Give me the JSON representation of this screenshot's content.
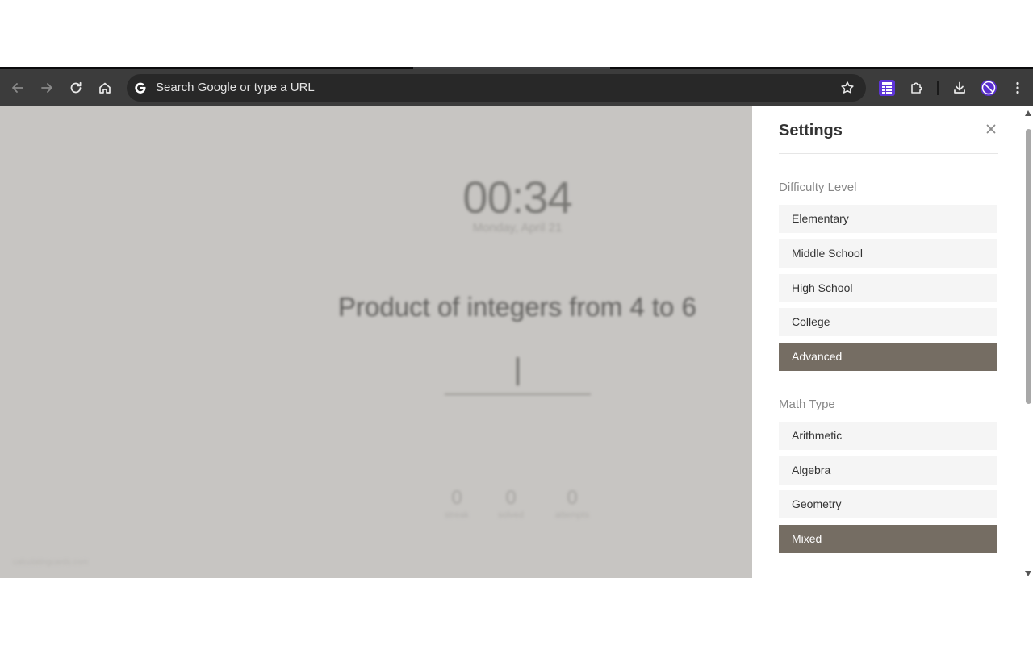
{
  "browser": {
    "omnibox_placeholder": "Search Google or type a URL",
    "icons": [
      "back-icon",
      "forward-icon",
      "reload-icon",
      "home-icon",
      "google-icon",
      "bookmark-star-icon",
      "calculator-extension-icon",
      "extensions-puzzle-icon",
      "download-icon",
      "profile-avatar-icon",
      "menu-kebab-icon"
    ]
  },
  "app": {
    "clock": "00:34",
    "date": "Monday, April 21",
    "problem": "Product of integers from 4 to 6",
    "stats": [
      {
        "value": "0",
        "label": "streak"
      },
      {
        "value": "0",
        "label": "solved"
      },
      {
        "value": "0",
        "label": "attempts"
      }
    ],
    "footer": "calculatingcards.com"
  },
  "settings": {
    "title": "Settings",
    "difficulty": {
      "label": "Difficulty Level",
      "options": [
        "Elementary",
        "Middle School",
        "High School",
        "College",
        "Advanced"
      ],
      "selected": "Advanced"
    },
    "math_type": {
      "label": "Math Type",
      "options": [
        "Arithmetic",
        "Algebra",
        "Geometry",
        "Mixed"
      ],
      "selected": "Mixed"
    }
  },
  "colors": {
    "toolbar": "#3c3c3c",
    "omnibox": "#282828",
    "overlay_bg": "#c7c5c2",
    "active_option": "#756d63",
    "option_bg": "#f5f5f5",
    "extension_purple": "#5e35d8"
  }
}
